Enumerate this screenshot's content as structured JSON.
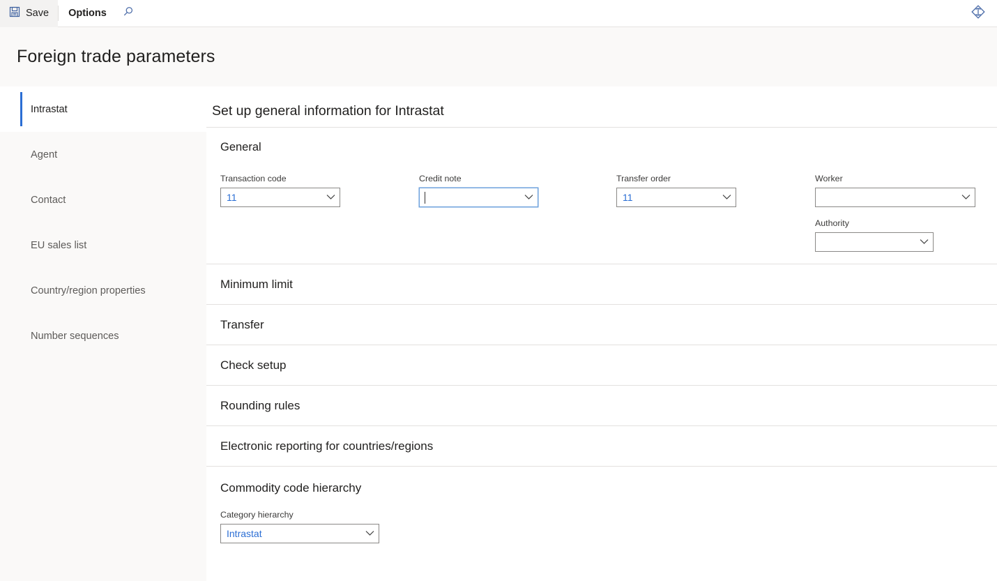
{
  "toolbar": {
    "save_label": "Save",
    "options_label": "Options",
    "save_icon": "save-floppy-icon",
    "search_icon": "search-icon",
    "diamond_icon": "diamond-icon"
  },
  "page": {
    "title": "Foreign trade parameters"
  },
  "sidebar": {
    "items": [
      {
        "label": "Intrastat",
        "selected": true
      },
      {
        "label": "Agent",
        "selected": false
      },
      {
        "label": "Contact",
        "selected": false
      },
      {
        "label": "EU sales list",
        "selected": false
      },
      {
        "label": "Country/region properties",
        "selected": false
      },
      {
        "label": "Number sequences",
        "selected": false
      }
    ]
  },
  "content": {
    "heading": "Set up general information for Intrastat",
    "general": {
      "title": "General",
      "fields": {
        "transaction_code": {
          "label": "Transaction code",
          "value": "11"
        },
        "credit_note": {
          "label": "Credit note",
          "value": "",
          "focused": true
        },
        "transfer_order": {
          "label": "Transfer order",
          "value": "11"
        },
        "worker": {
          "label": "Worker",
          "value": ""
        },
        "authority": {
          "label": "Authority",
          "value": ""
        }
      }
    },
    "sections": [
      {
        "title": "Minimum limit"
      },
      {
        "title": "Transfer"
      },
      {
        "title": "Check setup"
      },
      {
        "title": "Rounding rules"
      },
      {
        "title": "Electronic reporting for countries/regions"
      }
    ],
    "commodity": {
      "title": "Commodity code hierarchy",
      "category_hierarchy": {
        "label": "Category hierarchy",
        "value": "Intrastat"
      }
    }
  },
  "colors": {
    "accent": "#2b6ed4",
    "page_bg": "#faf9f8",
    "content_bg": "#ffffff",
    "border": "#8a8886",
    "divider": "#e3e1df",
    "focus_border": "#6ca0dc"
  }
}
